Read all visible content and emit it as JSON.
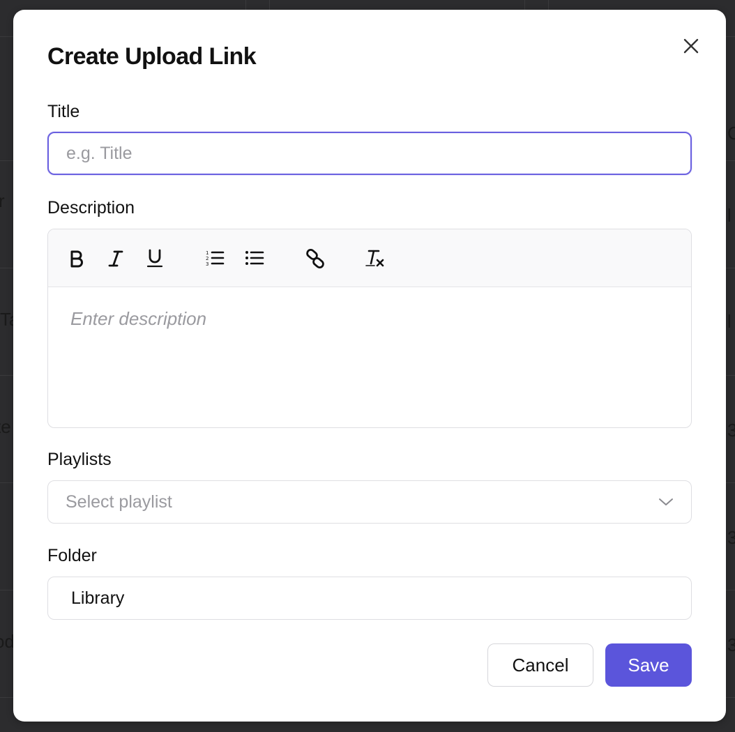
{
  "background": {
    "fragments": [
      "r",
      "Ta",
      "te",
      "od",
      "C",
      "l",
      "l",
      "3",
      "3",
      "3"
    ]
  },
  "modal": {
    "title": "Create Upload Link",
    "close_icon": "close-icon",
    "title_field": {
      "label": "Title",
      "placeholder": "e.g. Title",
      "value": ""
    },
    "description_field": {
      "label": "Description",
      "toolbar": [
        {
          "name": "bold-icon"
        },
        {
          "name": "italic-icon"
        },
        {
          "name": "underline-icon"
        },
        {
          "name": "ordered-list-icon"
        },
        {
          "name": "bullet-list-icon"
        },
        {
          "name": "link-icon"
        },
        {
          "name": "clear-format-icon"
        }
      ],
      "placeholder": "Enter description"
    },
    "playlists_field": {
      "label": "Playlists",
      "placeholder": "Select playlist",
      "icon": "chevron-down-icon"
    },
    "folder_field": {
      "label": "Folder",
      "value": "Library"
    },
    "cancel_label": "Cancel",
    "save_label": "Save",
    "accent_color": "#5b55db",
    "focus_color": "#6a60e0"
  }
}
